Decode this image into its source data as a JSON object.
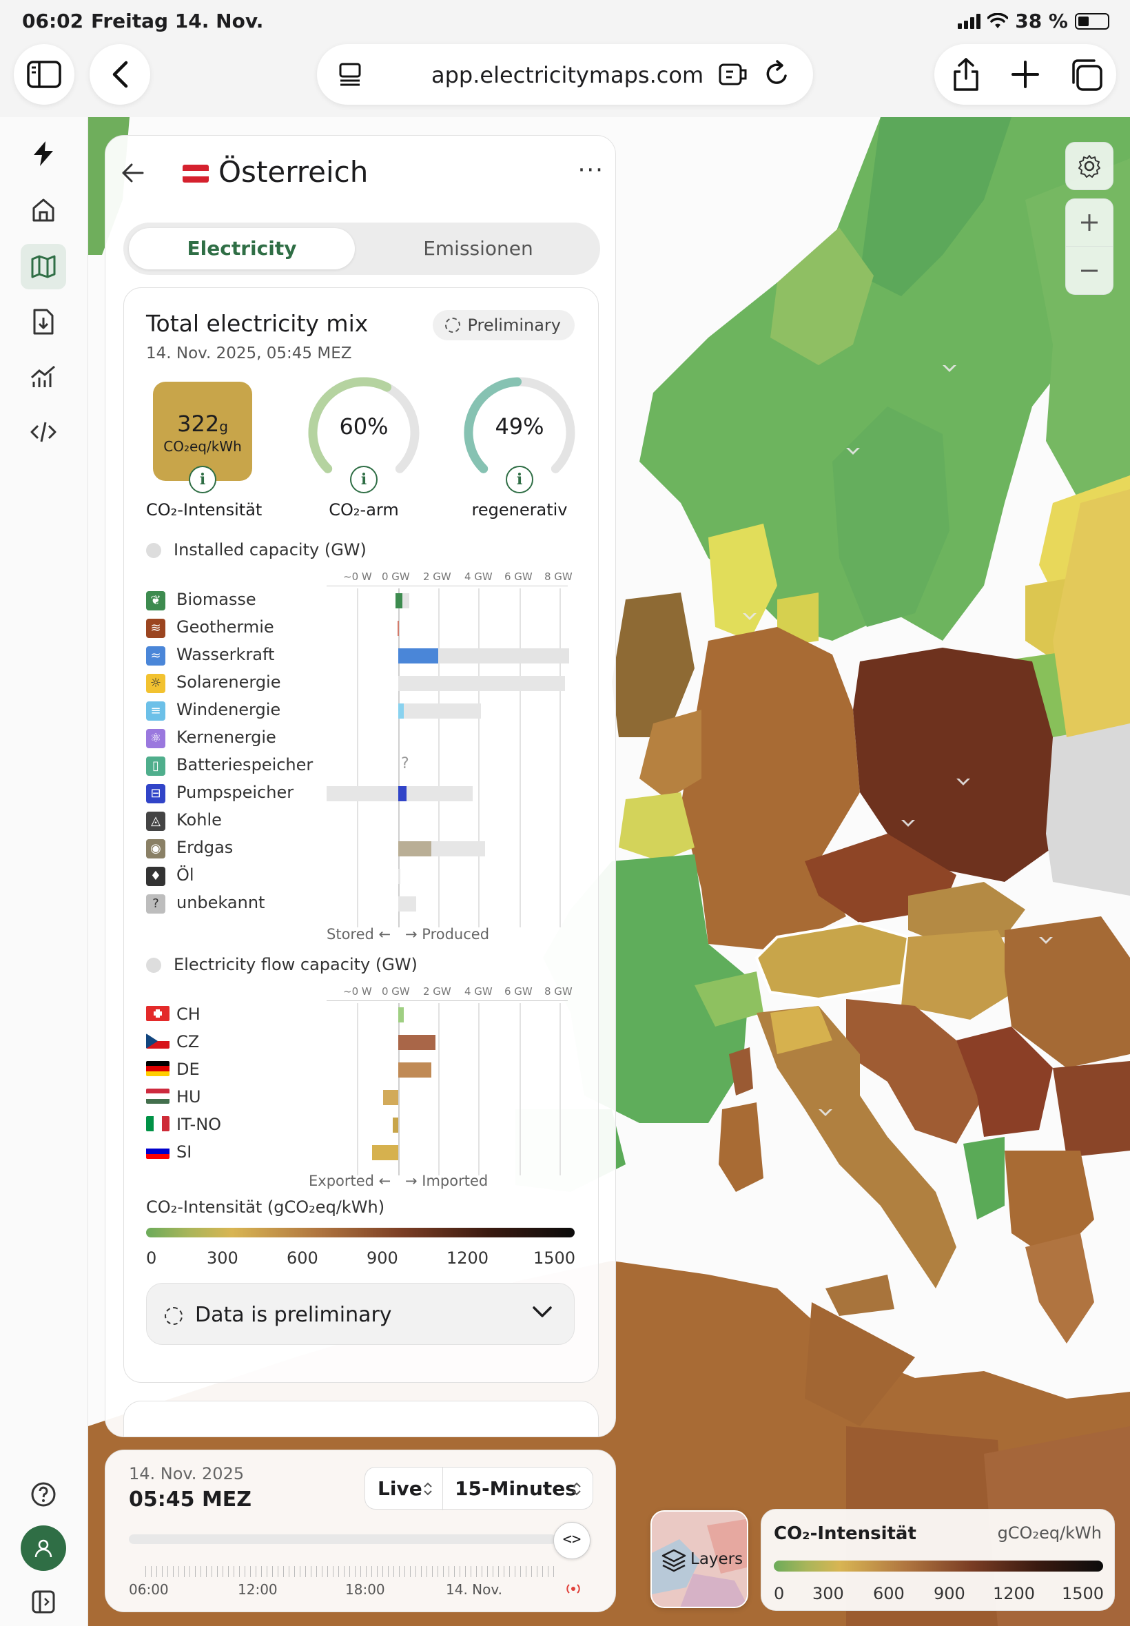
{
  "status": {
    "time": "06:02",
    "date": "Freitag 14. Nov.",
    "battery": "38 %"
  },
  "browser": {
    "url": "app.electricitymaps.com"
  },
  "panel": {
    "country": "Österreich",
    "more": "···",
    "tabs": {
      "active": "Electricity",
      "inactive": "Emissionen"
    },
    "mix": {
      "title": "Total electricity mix",
      "date": "14. Nov. 2025, 05:45 MEZ",
      "chip": "Preliminary",
      "co2_value": "322",
      "co2_value_unit": "g",
      "co2_unit": "CO₂eq/kWh",
      "co2_label": "CO₂-Intensität",
      "lowcarbon_pct": "60%",
      "lowcarbon_label": "CO₂-arm",
      "lowcarbon_value": 60,
      "renewable_pct": "49%",
      "renewable_label": "regenerativ",
      "renewable_value": 49,
      "gauge_colors": {
        "lowcarbon": "#b5d3a0",
        "renewable": "#86c2b2",
        "track": "#e4e4e4"
      },
      "co2_color": "#c8a54a"
    },
    "capacity": {
      "title": "Installed capacity (GW)",
      "scale": [
        "~0 W",
        "0 GW",
        "2 GW",
        "4 GW",
        "6 GW",
        "8 GW"
      ],
      "rows": [
        {
          "label": "Biomasse",
          "icon": "leaf-icon",
          "color": "#3d8b4f"
        },
        {
          "label": "Geothermie",
          "icon": "geothermal-icon",
          "color": "#9b4520"
        },
        {
          "label": "Wasserkraft",
          "icon": "water-icon",
          "color": "#4a86d8"
        },
        {
          "label": "Solarenergie",
          "icon": "sun-icon",
          "color": "#f2c230"
        },
        {
          "label": "Windenergie",
          "icon": "wind-icon",
          "color": "#6cc0e8"
        },
        {
          "label": "Kernenergie",
          "icon": "atom-icon",
          "color": "#9a78de"
        },
        {
          "label": "Batteriespeicher",
          "icon": "battery-icon",
          "color": "#4fae8c"
        },
        {
          "label": "Pumpspeicher",
          "icon": "pump-icon",
          "color": "#3144c8"
        },
        {
          "label": "Kohle",
          "icon": "coal-icon",
          "color": "#444444"
        },
        {
          "label": "Erdgas",
          "icon": "gas-icon",
          "color": "#8a8066"
        },
        {
          "label": "Öl",
          "icon": "oil-icon",
          "color": "#333333"
        },
        {
          "label": "unbekannt",
          "icon": "unknown-icon",
          "color": "#bdbdbd"
        }
      ],
      "unknown_mark": "?",
      "stored": "Stored ←",
      "produced": "→ Produced"
    },
    "flow": {
      "title": "Electricity flow capacity (GW)",
      "scale": [
        "~0 W",
        "0 GW",
        "2 GW",
        "4 GW",
        "6 GW",
        "8 GW"
      ],
      "rows": [
        {
          "label": "CH"
        },
        {
          "label": "CZ"
        },
        {
          "label": "DE"
        },
        {
          "label": "HU"
        },
        {
          "label": "IT-NO"
        },
        {
          "label": "SI"
        }
      ],
      "exported": "Exported ←",
      "imported": "→ Imported"
    },
    "intensity": {
      "title": "CO₂-Intensität (gCO₂eq/kWh)",
      "ticks": [
        "0",
        "300",
        "600",
        "900",
        "1200",
        "1500"
      ]
    },
    "preliminary_note": "Data is preliminary"
  },
  "timebar": {
    "date": "14. Nov. 2025",
    "time": "05:45 MEZ",
    "mode": "Live",
    "resolution": "15-Minutes",
    "ticks": [
      "06:00",
      "12:00",
      "18:00",
      "14. Nov."
    ]
  },
  "layers": {
    "label": "Layers"
  },
  "map_legend": {
    "title": "CO₂-Intensität",
    "unit": "gCO₂eq/kWh",
    "ticks": [
      "0",
      "300",
      "600",
      "900",
      "1200",
      "1500"
    ]
  }
}
